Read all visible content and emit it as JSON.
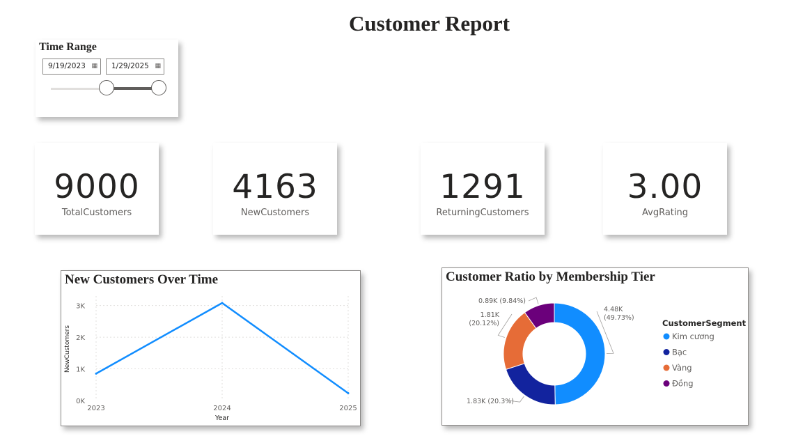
{
  "page": {
    "title": "Customer Report"
  },
  "slicer": {
    "title": "Time Range",
    "start_date": "9/19/2023",
    "end_date": "1/29/2025",
    "calendar_icon": "calendar-icon"
  },
  "kpis": [
    {
      "value": "9000",
      "label": "TotalCustomers"
    },
    {
      "value": "4163",
      "label": "NewCustomers"
    },
    {
      "value": "1291",
      "label": "ReturningCustomers"
    },
    {
      "value": "3.00",
      "label": "AvgRating"
    }
  ],
  "chart_data": [
    {
      "type": "line",
      "title": "New Customers Over Time",
      "xlabel": "Year",
      "ylabel": "NewCustomers",
      "x": [
        "2023",
        "2024",
        "2025"
      ],
      "y_ticks": [
        "0K",
        "1K",
        "2K",
        "3K"
      ],
      "ylim": [
        0,
        3300
      ],
      "grid": true,
      "series": [
        {
          "values": [
            850,
            3080,
            230
          ],
          "color": "#118DFF"
        }
      ]
    },
    {
      "type": "pie",
      "title": "Customer Ratio by Membership Tier",
      "legend_title": "CustomerSegment",
      "legend_position": "right",
      "slices": [
        {
          "name": "Kim cương",
          "value": 4480,
          "label": "4.48K",
          "pct": "(49.73%)",
          "color": "#118DFF"
        },
        {
          "name": "Bạc",
          "value": 1830,
          "label": "1.83K (20.3%)",
          "pct": "",
          "color": "#12239E"
        },
        {
          "name": "Vàng",
          "value": 1810,
          "label": "1.81K",
          "pct": "(20.12%)",
          "color": "#E66C37"
        },
        {
          "name": "Đồng",
          "value": 890,
          "label": "0.89K (9.84%)",
          "pct": "",
          "color": "#6B007B"
        }
      ]
    }
  ]
}
